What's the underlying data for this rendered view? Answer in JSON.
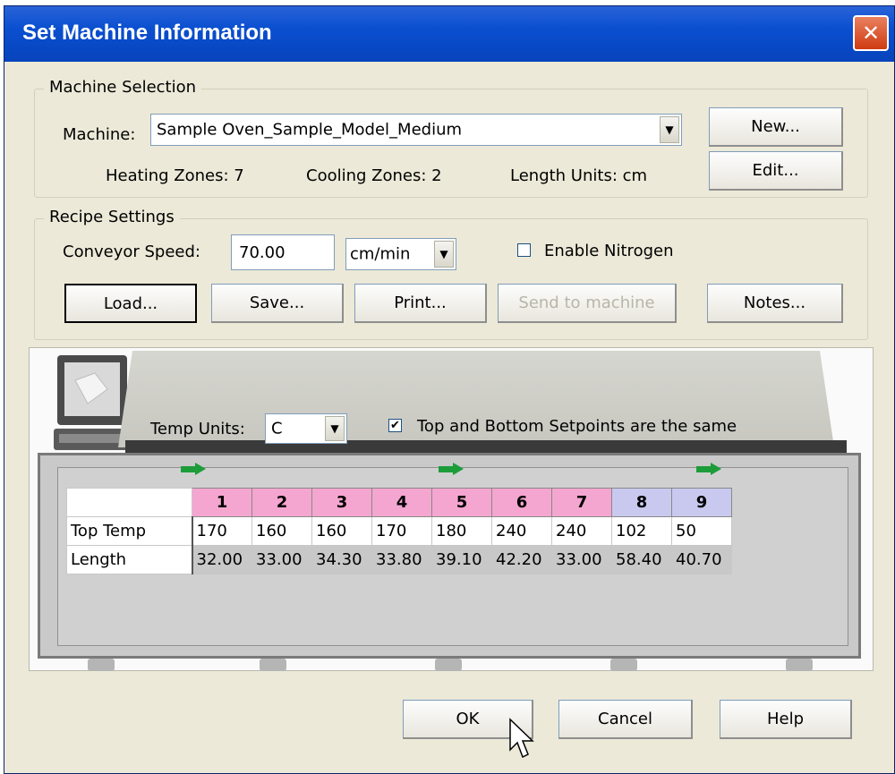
{
  "window": {
    "title": "Set Machine Information",
    "close_symbol": "✕"
  },
  "machine_selection": {
    "legend": "Machine Selection",
    "machine_label": "Machine:",
    "machine_value": "Sample Oven_Sample_Model_Medium",
    "new_button": "New...",
    "edit_button": "Edit...",
    "heating_zones": "Heating Zones: 7",
    "cooling_zones": "Cooling Zones: 2",
    "length_units": "Length Units: cm"
  },
  "recipe_settings": {
    "legend": "Recipe Settings",
    "conveyor_label": "Conveyor Speed:",
    "conveyor_value": "70.00",
    "speed_unit": "cm/min",
    "enable_nitrogen_label": "Enable Nitrogen",
    "enable_nitrogen_checked": false,
    "load_button": "Load...",
    "save_button": "Save...",
    "print_button": "Print...",
    "send_button": "Send to machine",
    "notes_button": "Notes..."
  },
  "oven": {
    "temp_units_label": "Temp Units:",
    "temp_units_value": "C",
    "same_setpoints_label": "Top and Bottom Setpoints are the same",
    "same_setpoints_checked": true,
    "checkmark": "✔",
    "colors": {
      "heat_zone": "#f5a6d0",
      "cool_zone": "#c9c9f0",
      "flow_arrow": "#1c9d3a"
    },
    "zones": [
      {
        "num": "1",
        "type": "heat",
        "top_temp": "170",
        "length": "32.00"
      },
      {
        "num": "2",
        "type": "heat",
        "top_temp": "160",
        "length": "33.00"
      },
      {
        "num": "3",
        "type": "heat",
        "top_temp": "160",
        "length": "34.30"
      },
      {
        "num": "4",
        "type": "heat",
        "top_temp": "170",
        "length": "33.80"
      },
      {
        "num": "5",
        "type": "heat",
        "top_temp": "180",
        "length": "39.10"
      },
      {
        "num": "6",
        "type": "heat",
        "top_temp": "240",
        "length": "42.20"
      },
      {
        "num": "7",
        "type": "heat",
        "top_temp": "240",
        "length": "33.00"
      },
      {
        "num": "8",
        "type": "cool",
        "top_temp": "102",
        "length": "58.40"
      },
      {
        "num": "9",
        "type": "cool",
        "top_temp": "50",
        "length": "40.70"
      }
    ],
    "rows": {
      "top_temp": "Top Temp",
      "length": "Length"
    }
  },
  "footer": {
    "ok_button": "OK",
    "cancel_button": "Cancel",
    "help_button": "Help"
  }
}
